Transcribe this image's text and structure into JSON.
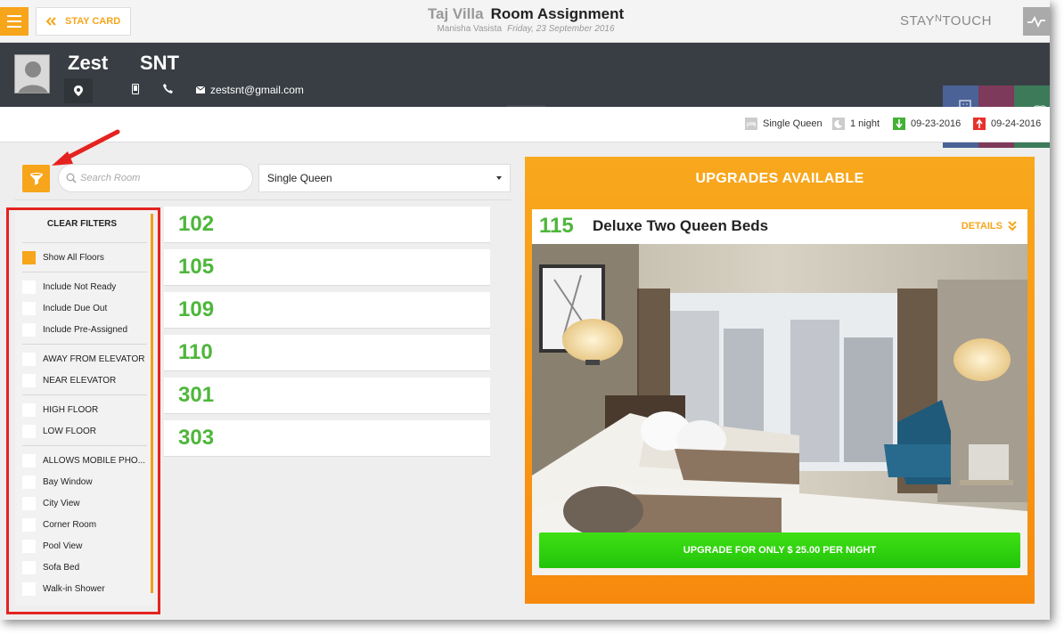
{
  "topbar": {
    "back_label": "STAY CARD",
    "hotel_name": "Taj Villa",
    "page_title": "Room Assignment",
    "user_name": "Manisha Vasista",
    "date": "Friday, 23 September 2016",
    "logo": {
      "part1": "STAY",
      "part2": "N",
      "part3": "TOUCH"
    }
  },
  "guest": {
    "first_name": "Zest",
    "last_name": "SNT",
    "email": "zestsnt@gmail.com"
  },
  "stay_info": {
    "room_type": "Single Queen",
    "nights": "1 night",
    "arrival": "09-23-2016",
    "departure": "09-24-2016"
  },
  "search": {
    "placeholder": "Search Room"
  },
  "room_type_select": {
    "selected": "Single Queen"
  },
  "filters": {
    "clear_label": "CLEAR FILTERS",
    "groups": [
      [
        {
          "label": "Show All Floors",
          "checked": true
        }
      ],
      [
        {
          "label": "Include Not Ready",
          "checked": false
        },
        {
          "label": "Include Due Out",
          "checked": false
        },
        {
          "label": "Include Pre-Assigned",
          "checked": false
        }
      ],
      [
        {
          "label": "AWAY FROM ELEVATOR",
          "checked": false
        },
        {
          "label": "NEAR ELEVATOR",
          "checked": false
        }
      ],
      [
        {
          "label": "HIGH FLOOR",
          "checked": false
        },
        {
          "label": "LOW FLOOR",
          "checked": false
        }
      ],
      [
        {
          "label": "ALLOWS MOBILE PHO...",
          "checked": false
        },
        {
          "label": "Bay Window",
          "checked": false
        },
        {
          "label": "City View",
          "checked": false
        },
        {
          "label": "Corner Room",
          "checked": false
        },
        {
          "label": "Pool View",
          "checked": false
        },
        {
          "label": "Sofa Bed",
          "checked": false
        },
        {
          "label": "Walk-in Shower",
          "checked": false
        }
      ]
    ]
  },
  "rooms": [
    "102",
    "105",
    "109",
    "110",
    "301",
    "303"
  ],
  "upgrades": {
    "title": "UPGRADES AVAILABLE",
    "room_number": "115",
    "room_name": "Deluxe Two Queen Beds",
    "details_label": "DETAILS",
    "button_label": "UPGRADE FOR ONLY $ 25.00 PER NIGHT"
  },
  "colors": {
    "accent": "#f7a51b",
    "room_number_green": "#4eb63b",
    "guest_bar": "#393e44",
    "upgrade_button": "#2ed10f",
    "annotation_red": "#e42320"
  }
}
